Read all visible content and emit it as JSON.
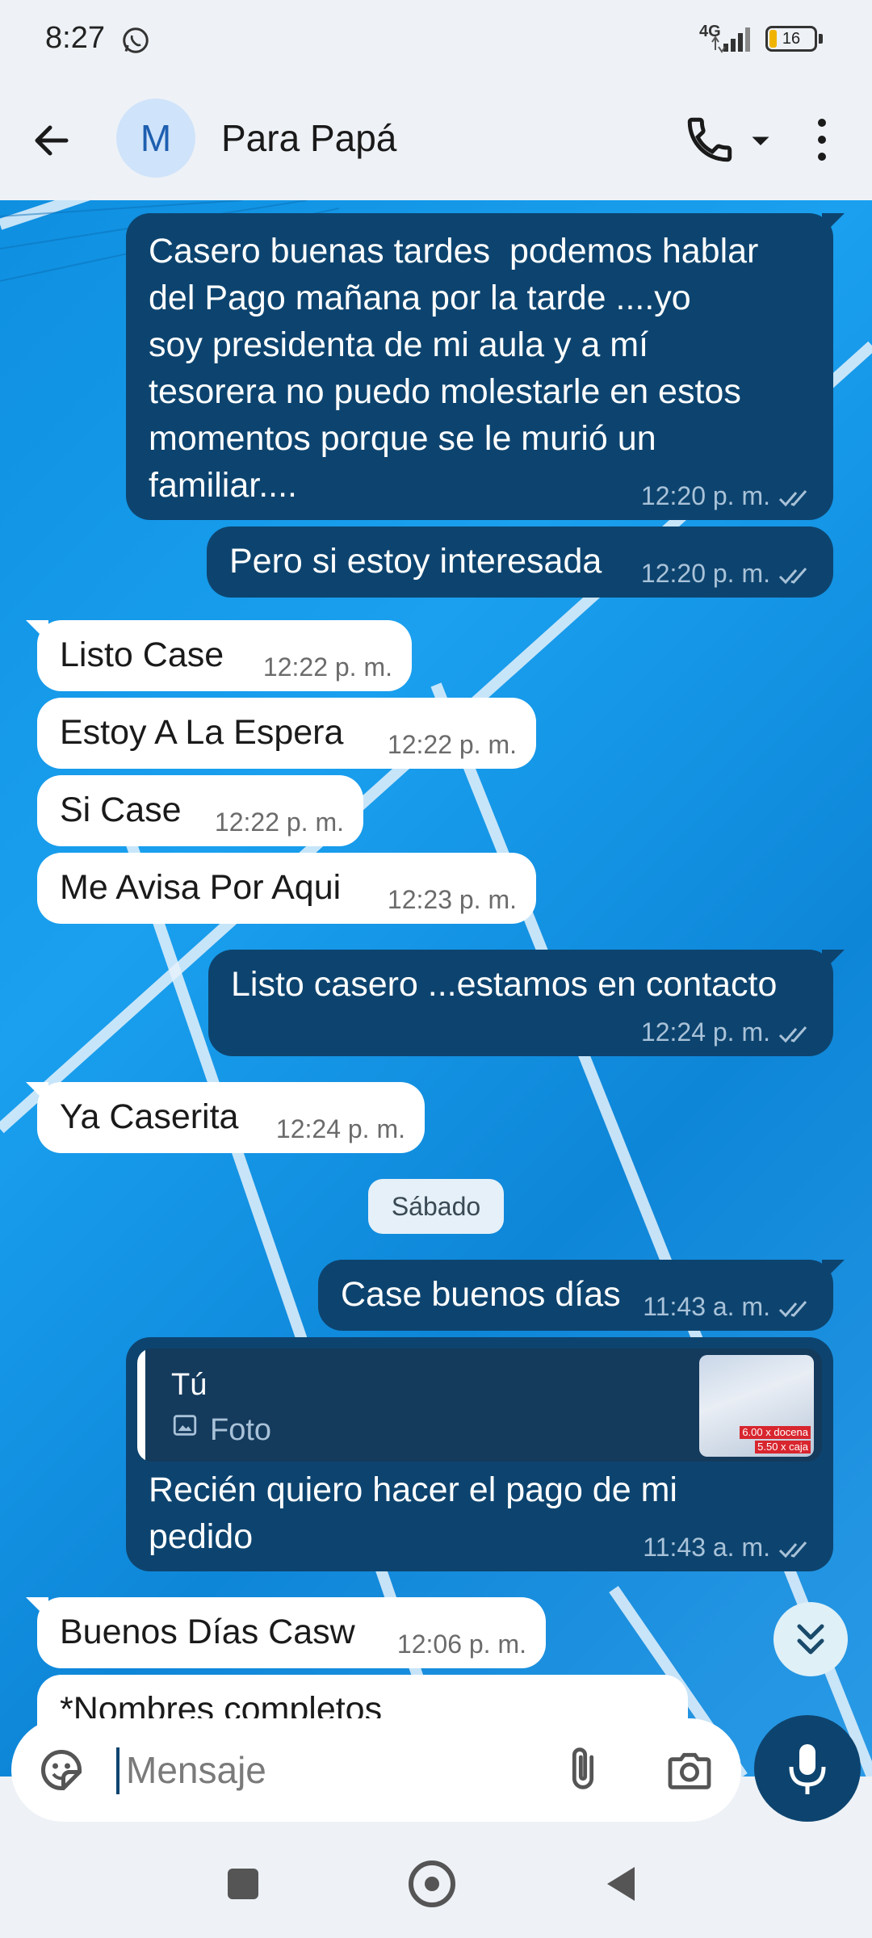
{
  "status_bar": {
    "time": "8:27",
    "network": "4G",
    "battery": "16",
    "battery_level": 0.16,
    "icons": [
      "whatsapp-icon",
      "signal-icon",
      "battery-icon"
    ]
  },
  "header": {
    "avatar_initial": "M",
    "title": "Para Papá",
    "icons": [
      "back-arrow-icon",
      "phone-icon",
      "dropdown-caret-icon",
      "more-vertical-icon"
    ]
  },
  "messages": [
    {
      "dir": "out",
      "text": "Casero buenas tardes  podemos hablar\ndel Pago mañana por la tarde ....yo\nsoy presidenta de mi aula y a mí\ntesorera no puedo molestarle en estos\nmomentos porque se le murió un\nfamiliar....",
      "time": "12:20 p. m.",
      "read": true
    },
    {
      "dir": "out",
      "text": "Pero si estoy interesada",
      "time": "12:20 p. m.",
      "read": true
    },
    {
      "dir": "in",
      "text": "Listo Case",
      "time": "12:22 p. m."
    },
    {
      "dir": "in",
      "text": "Estoy A La Espera",
      "time": "12:22 p. m."
    },
    {
      "dir": "in",
      "text": "Si Case",
      "time": "12:22 p. m."
    },
    {
      "dir": "in",
      "text": "Me Avisa Por Aqui",
      "time": "12:23 p. m."
    },
    {
      "dir": "out",
      "text": "Listo casero ...estamos en contacto",
      "time": "12:24 p. m.",
      "read": true
    },
    {
      "dir": "in",
      "text": "Ya Caserita",
      "time": "12:24 p. m."
    },
    {
      "dir": "out",
      "text": "Case buenos días",
      "time": "11:43 a. m.",
      "read": true
    },
    {
      "dir": "out",
      "text": "Recién quiero hacer el pago de mi\npedido",
      "time": "11:43 a. m.",
      "read": true,
      "quote": {
        "author": "Tú",
        "type": "Foto",
        "thumb_text": [
          "6.00 x docena",
          "5.50 x caja"
        ]
      }
    },
    {
      "dir": "in",
      "text": "Buenos Días Casw",
      "time": "12:06 p. m."
    },
    {
      "dir": "in",
      "text": "*Nombres completos",
      "time": ""
    }
  ],
  "date_separator": "Sábado",
  "composer": {
    "placeholder": "Mensaje",
    "icons": [
      "sticker-icon",
      "paperclip-icon",
      "camera-icon",
      "microphone-icon"
    ]
  },
  "scroll_button_icon": "double-chevron-down-icon",
  "nav": {
    "icons": [
      "recents-square-icon",
      "home-circle-icon",
      "back-triangle-icon"
    ]
  },
  "colors": {
    "outgoing_bubble": "#0d446f",
    "incoming_bubble": "#ffffff",
    "chat_background": "#1496e6",
    "accent": "#0d446f"
  }
}
